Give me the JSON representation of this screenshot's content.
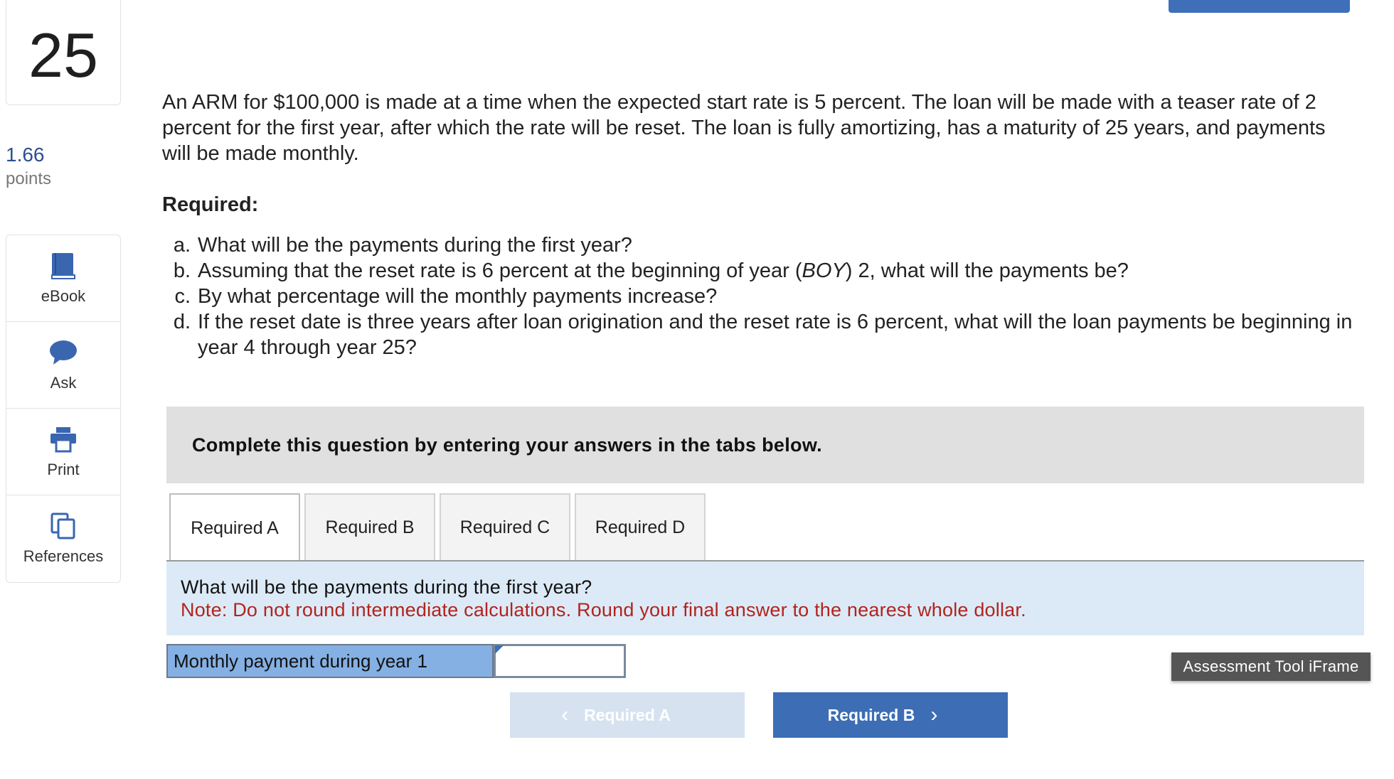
{
  "question": {
    "number": "25",
    "points_value": "1.66",
    "points_label": "points"
  },
  "tools": [
    {
      "label": "eBook",
      "icon": "book-icon"
    },
    {
      "label": "Ask",
      "icon": "chat-bubble-icon"
    },
    {
      "label": "Print",
      "icon": "printer-icon"
    },
    {
      "label": "References",
      "icon": "copy-documents-icon"
    }
  ],
  "problem": {
    "text": "An ARM for $100,000 is made at a time when the expected start rate is 5 percent. The loan will be made with a teaser rate of 2 percent for the first year, after which the rate will be reset. The loan is fully amortizing, has a maturity of 25 years, and payments will be made monthly.",
    "required_heading": "Required:",
    "items": [
      {
        "letter": "a.",
        "text_before": "What will be the payments during the first year?",
        "italic": "",
        "text_after": ""
      },
      {
        "letter": "b.",
        "text_before": "Assuming that the reset rate is 6 percent at the beginning of year (",
        "italic": "BOY",
        "text_after": ") 2, what will the payments be?"
      },
      {
        "letter": "c.",
        "text_before": "By what percentage will the monthly payments increase?",
        "italic": "",
        "text_after": ""
      },
      {
        "letter": "d.",
        "text_before": "If the reset date is three years after loan origination and the reset rate is 6 percent, what will the loan payments be beginning in year 4 through year 25?",
        "italic": "",
        "text_after": ""
      }
    ]
  },
  "instruction": "Complete this question by entering your answers in the tabs below.",
  "tabs": [
    {
      "label": "Required A",
      "active": true
    },
    {
      "label": "Required B",
      "active": false
    },
    {
      "label": "Required C",
      "active": false
    },
    {
      "label": "Required D",
      "active": false
    }
  ],
  "panel": {
    "question": "What will be the payments during the first year?",
    "note": "Note: Do not round intermediate calculations. Round your final answer to the nearest whole dollar."
  },
  "answer": {
    "label": "Monthly payment during year 1",
    "value": ""
  },
  "iframe_label": "Assessment Tool iFrame",
  "nav": {
    "prev_label": "Required A",
    "next_label": "Required B"
  },
  "colors": {
    "accent": "#3c6db5",
    "note_red": "#b2241d",
    "panel_bg": "#dceaf7",
    "label_bg": "#84b0e3"
  }
}
